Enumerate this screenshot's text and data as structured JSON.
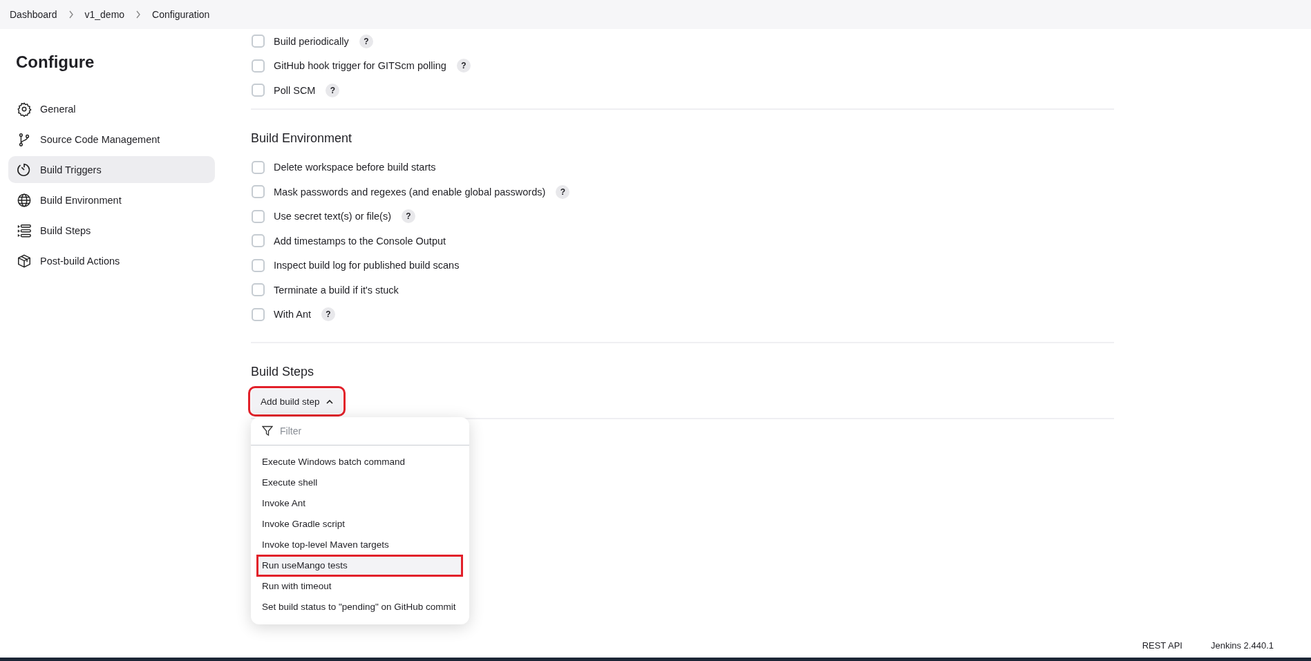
{
  "breadcrumbs": [
    {
      "label": "Dashboard"
    },
    {
      "label": "v1_demo"
    },
    {
      "label": "Configuration"
    }
  ],
  "sidebar": {
    "title": "Configure",
    "items": [
      {
        "label": "General",
        "selected": false
      },
      {
        "label": "Source Code Management",
        "selected": false
      },
      {
        "label": "Build Triggers",
        "selected": true
      },
      {
        "label": "Build Environment",
        "selected": false
      },
      {
        "label": "Build Steps",
        "selected": false
      },
      {
        "label": "Post-build Actions",
        "selected": false
      }
    ]
  },
  "build_triggers": {
    "items": [
      {
        "label": "Build periodically",
        "checked": false,
        "help": "?"
      },
      {
        "label": "GitHub hook trigger for GITScm polling",
        "checked": false,
        "help": "?"
      },
      {
        "label": "Poll SCM",
        "checked": false,
        "help": "?"
      }
    ]
  },
  "build_environment": {
    "title": "Build Environment",
    "items": [
      {
        "label": "Delete workspace before build starts",
        "checked": false
      },
      {
        "label": "Mask passwords and regexes (and enable global passwords)",
        "checked": false,
        "help": "?"
      },
      {
        "label": "Use secret text(s) or file(s)",
        "checked": false,
        "help": "?"
      },
      {
        "label": "Add timestamps to the Console Output",
        "checked": false
      },
      {
        "label": "Inspect build log for published build scans",
        "checked": false
      },
      {
        "label": "Terminate a build if it's stuck",
        "checked": false
      },
      {
        "label": "With Ant",
        "checked": false,
        "help": "?"
      }
    ]
  },
  "build_steps": {
    "title": "Build Steps",
    "add_button": {
      "label": "Add build step",
      "expanded": true,
      "annotated": true
    },
    "menu": {
      "filter_placeholder": "Filter",
      "items": [
        {
          "label": "Execute Windows batch command",
          "highlighted": false,
          "annotated": false
        },
        {
          "label": "Execute shell",
          "highlighted": false,
          "annotated": false
        },
        {
          "label": "Invoke Ant",
          "highlighted": false,
          "annotated": false
        },
        {
          "label": "Invoke Gradle script",
          "highlighted": false,
          "annotated": false
        },
        {
          "label": "Invoke top-level Maven targets",
          "highlighted": false,
          "annotated": false
        },
        {
          "label": "Run useMango tests",
          "highlighted": true,
          "annotated": true
        },
        {
          "label": "Run with timeout",
          "highlighted": false,
          "annotated": false
        },
        {
          "label": "Set build status to \"pending\" on GitHub commit",
          "highlighted": false,
          "annotated": false
        }
      ]
    }
  },
  "footer": {
    "links": [
      {
        "label": "REST API"
      },
      {
        "label": "Jenkins 2.440.1"
      }
    ]
  }
}
